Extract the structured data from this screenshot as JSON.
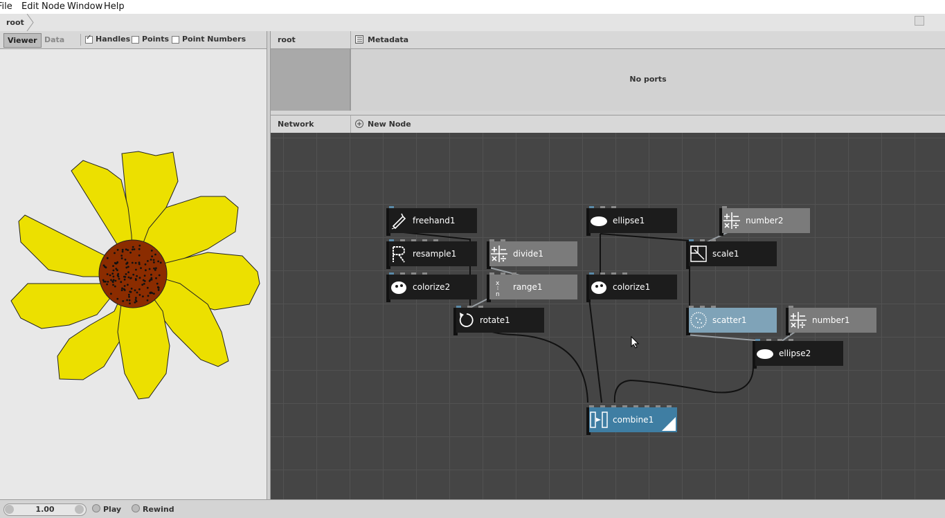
{
  "menu": [
    "File",
    "Edit",
    "Node",
    "Window",
    "Help"
  ],
  "address": {
    "crumb": "root"
  },
  "viewer": {
    "tabs": [
      "Viewer",
      "Data"
    ],
    "options": [
      {
        "label": "Handles",
        "checked": true
      },
      {
        "label": "Points",
        "checked": false
      },
      {
        "label": "Point Numbers",
        "checked": false
      }
    ]
  },
  "params": {
    "title": "root",
    "metadata_label": "Metadata",
    "empty_text": "No ports"
  },
  "network": {
    "title": "Network",
    "new_node_label": "New Node",
    "nodes": [
      {
        "name": "freehand1",
        "icon": "freehand-icon",
        "style": "dark"
      },
      {
        "name": "resample1",
        "icon": "resample-icon",
        "style": "dark"
      },
      {
        "name": "colorize2",
        "icon": "palette-icon",
        "style": "dark"
      },
      {
        "name": "divide1",
        "icon": "math-icon",
        "style": "gray"
      },
      {
        "name": "range1",
        "icon": "range-icon",
        "style": "gray"
      },
      {
        "name": "rotate1",
        "icon": "rotate-icon",
        "style": "dark"
      },
      {
        "name": "ellipse1",
        "icon": "ellipse-icon",
        "style": "dark"
      },
      {
        "name": "colorize1",
        "icon": "palette-icon",
        "style": "dark"
      },
      {
        "name": "number2",
        "icon": "math-icon",
        "style": "gray"
      },
      {
        "name": "scale1",
        "icon": "scale-icon",
        "style": "dark"
      },
      {
        "name": "scatter1",
        "icon": "scatter-icon",
        "style": "selected"
      },
      {
        "name": "number1",
        "icon": "math-icon",
        "style": "gray"
      },
      {
        "name": "ellipse2",
        "icon": "ellipse-icon",
        "style": "dark"
      },
      {
        "name": "combine1",
        "icon": "combine-icon",
        "style": "rendered"
      }
    ]
  },
  "playback": {
    "frame": "1.00",
    "play_label": "Play",
    "rewind_label": "Rewind"
  },
  "colors": {
    "petal": "#ece000",
    "center": "#8b2c00",
    "network_bg": "#454545",
    "node_dark": "#1c1c1c",
    "node_gray": "#7b7b7b",
    "node_selected": "#7fa3b8",
    "node_rendered": "#3f7ea3"
  }
}
